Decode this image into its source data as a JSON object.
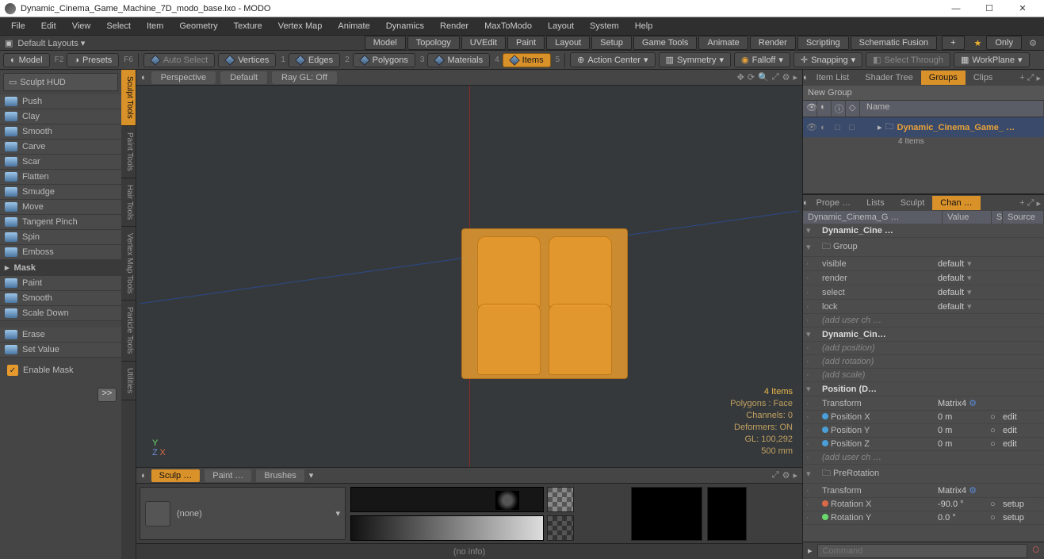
{
  "title": "Dynamic_Cinema_Game_Machine_7D_modo_base.lxo - MODO",
  "menu": [
    "File",
    "Edit",
    "View",
    "Select",
    "Item",
    "Geometry",
    "Texture",
    "Vertex Map",
    "Animate",
    "Dynamics",
    "Render",
    "MaxToModo",
    "Layout",
    "System",
    "Help"
  ],
  "layout": {
    "default": "Default Layouts ▾",
    "tabs": [
      "Model",
      "Topology",
      "UVEdit",
      "Paint",
      "Layout",
      "Setup",
      "Game Tools",
      "Animate",
      "Render",
      "Scripting",
      "Schematic Fusion"
    ],
    "only": "Only"
  },
  "sec": {
    "model": "Model",
    "f2": "F2",
    "presets": "Presets",
    "f6": "F6",
    "autoselect": "Auto Select",
    "vertices": "Vertices",
    "vn": "1",
    "edges": "Edges",
    "en": "2",
    "polygons": "Polygons",
    "pn": "3",
    "materials": "Materials",
    "mn": "4",
    "items": "Items",
    "in": "5",
    "action": "Action Center",
    "symmetry": "Symmetry",
    "falloff": "Falloff",
    "snapping": "Snapping",
    "selthrough": "Select Through",
    "workplane": "WorkPlane"
  },
  "leftpanel": {
    "hud": "Sculpt HUD",
    "tools": [
      "Push",
      "Clay",
      "Smooth",
      "Carve",
      "Scar",
      "Flatten",
      "Smudge",
      "Move",
      "Tangent Pinch",
      "Spin",
      "Emboss"
    ],
    "sep": "Mask",
    "tools2": [
      "Paint",
      "Smooth",
      "Scale Down"
    ],
    "tools3": [
      "Erase",
      "Set Value"
    ],
    "enable": "Enable Mask",
    "more": ">>",
    "tabs": [
      "Sculpt Tools",
      "Paint Tools",
      "Hair Tools",
      "Vertex Map Tools",
      "Particle Tools",
      "Utilities"
    ]
  },
  "vp": {
    "tabs": [
      "Perspective",
      "Default",
      "Ray GL: Off"
    ],
    "info": {
      "l1": "4 Items",
      "l2": "Polygons : Face",
      "l3": "Channels: 0",
      "l4": "Deformers: ON",
      "l5": "GL: 100,292",
      "l6": "500 mm"
    }
  },
  "midtabs": [
    "Sculp …",
    "Paint …",
    "Brushes"
  ],
  "bselect": "(none)",
  "right": {
    "toptabs": [
      "Item List",
      "Shader Tree",
      "Groups",
      "Clips"
    ],
    "newgroup": "New Group",
    "headname": "Name",
    "item": {
      "name": "Dynamic_Cinema_Game_ …",
      "count": "4 Items"
    },
    "bottomtabs": [
      "Prope …",
      "Lists",
      "Sculpt",
      "Chan …"
    ],
    "chead": {
      "name": "Dynamic_Cinema_G …",
      "value": "Value",
      "s": "S",
      "source": "Source"
    },
    "rows": [
      {
        "n": "Dynamic_Cine …",
        "bold": true,
        "ind": "▾"
      },
      {
        "n": "Group",
        "bold": false,
        "ind": "▾",
        "ic": true
      },
      {
        "n": "visible",
        "v": "default",
        "dd": "▾"
      },
      {
        "n": "render",
        "v": "default",
        "dd": "▾"
      },
      {
        "n": "select",
        "v": "default",
        "dd": "▾"
      },
      {
        "n": "lock",
        "v": "default",
        "dd": "▾"
      },
      {
        "n": "(add user ch …",
        "it": true
      },
      {
        "n": "Dynamic_Cin…",
        "bold": true,
        "ind": "▾"
      },
      {
        "n": "(add position)",
        "it": true
      },
      {
        "n": "(add rotation)",
        "it": true
      },
      {
        "n": "(add scale)",
        "it": true
      },
      {
        "n": "Position (D…",
        "bold": true,
        "ind": "▾"
      },
      {
        "n": "Transform",
        "v": "Matrix4",
        "gear": true
      },
      {
        "n": "Position X",
        "v": "0 m",
        "so": "edit",
        "dot": "b"
      },
      {
        "n": "Position Y",
        "v": "0 m",
        "so": "edit",
        "dot": "b"
      },
      {
        "n": "Position Z",
        "v": "0 m",
        "so": "edit",
        "dot": "b"
      },
      {
        "n": "(add user ch …",
        "it": true
      },
      {
        "n": "PreRotation",
        "bold": false,
        "ind": "▾",
        "ic": true
      },
      {
        "n": "Transform",
        "v": "Matrix4",
        "gear": true
      },
      {
        "n": "Rotation X",
        "v": "-90.0 °",
        "so": "setup",
        "dot": "r"
      },
      {
        "n": "Rotation Y",
        "v": "0.0 °",
        "so": "setup",
        "dot": "g"
      }
    ]
  },
  "cmd": "Command",
  "status": "(no info)"
}
